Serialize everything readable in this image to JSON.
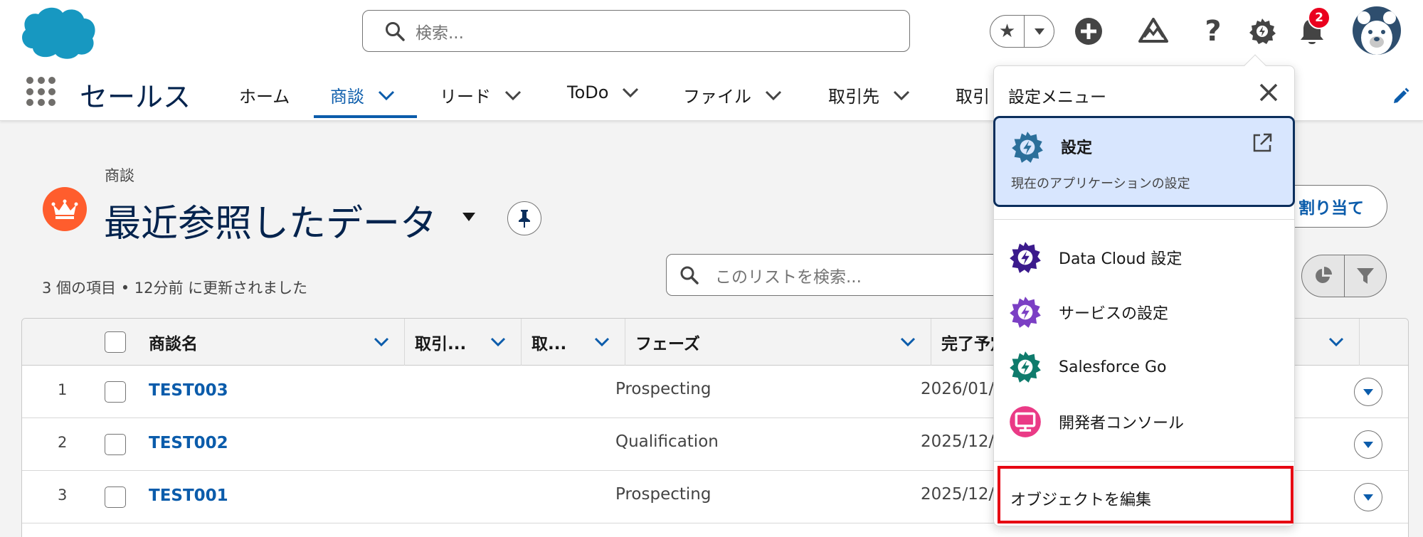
{
  "header": {
    "search_placeholder": "検索...",
    "notification_count": "2"
  },
  "nav": {
    "app_name": "セールス",
    "items": [
      {
        "label": "ホーム"
      },
      {
        "label": "商談"
      },
      {
        "label": "リード"
      },
      {
        "label": "ToDo"
      },
      {
        "label": "ファイル"
      },
      {
        "label": "取引先"
      },
      {
        "label": "取引"
      }
    ]
  },
  "page": {
    "object_label": "商談",
    "list_title": "最近参照したデータ",
    "assign_button": "割り当て",
    "status_text": "3 個の項目 • 12分前 に更新されました",
    "list_search_placeholder": "このリストを検索..."
  },
  "table": {
    "columns": [
      "商談名",
      "取引...",
      "取...",
      "フェーズ",
      "完了予定"
    ],
    "rows": [
      {
        "num": "1",
        "name": "TEST003",
        "phase": "Prospecting",
        "date": "2026/01/"
      },
      {
        "num": "2",
        "name": "TEST002",
        "phase": "Qualification",
        "date": "2025/12/"
      },
      {
        "num": "3",
        "name": "TEST001",
        "phase": "Prospecting",
        "date": "2025/12/"
      }
    ]
  },
  "setup_menu": {
    "title": "設定メニュー",
    "highlight": {
      "title": "設定",
      "subtitle": "現在のアプリケーションの設定"
    },
    "items": [
      {
        "label": "Data Cloud 設定",
        "color": "#3b1a8c"
      },
      {
        "label": "サービスの設定",
        "color": "#7b3fc4"
      },
      {
        "label": "Salesforce Go",
        "color": "#0f7b6c"
      },
      {
        "label": "開発者コンソール",
        "color": "#ea3a86"
      }
    ],
    "edit_object": "オブジェクトを編集"
  },
  "colors": {
    "brand_blue": "#0b5cab",
    "salesforce_cloud": "#1798c1",
    "opportunity_orange": "#ff5d2d",
    "highlight_red": "#e60012"
  }
}
